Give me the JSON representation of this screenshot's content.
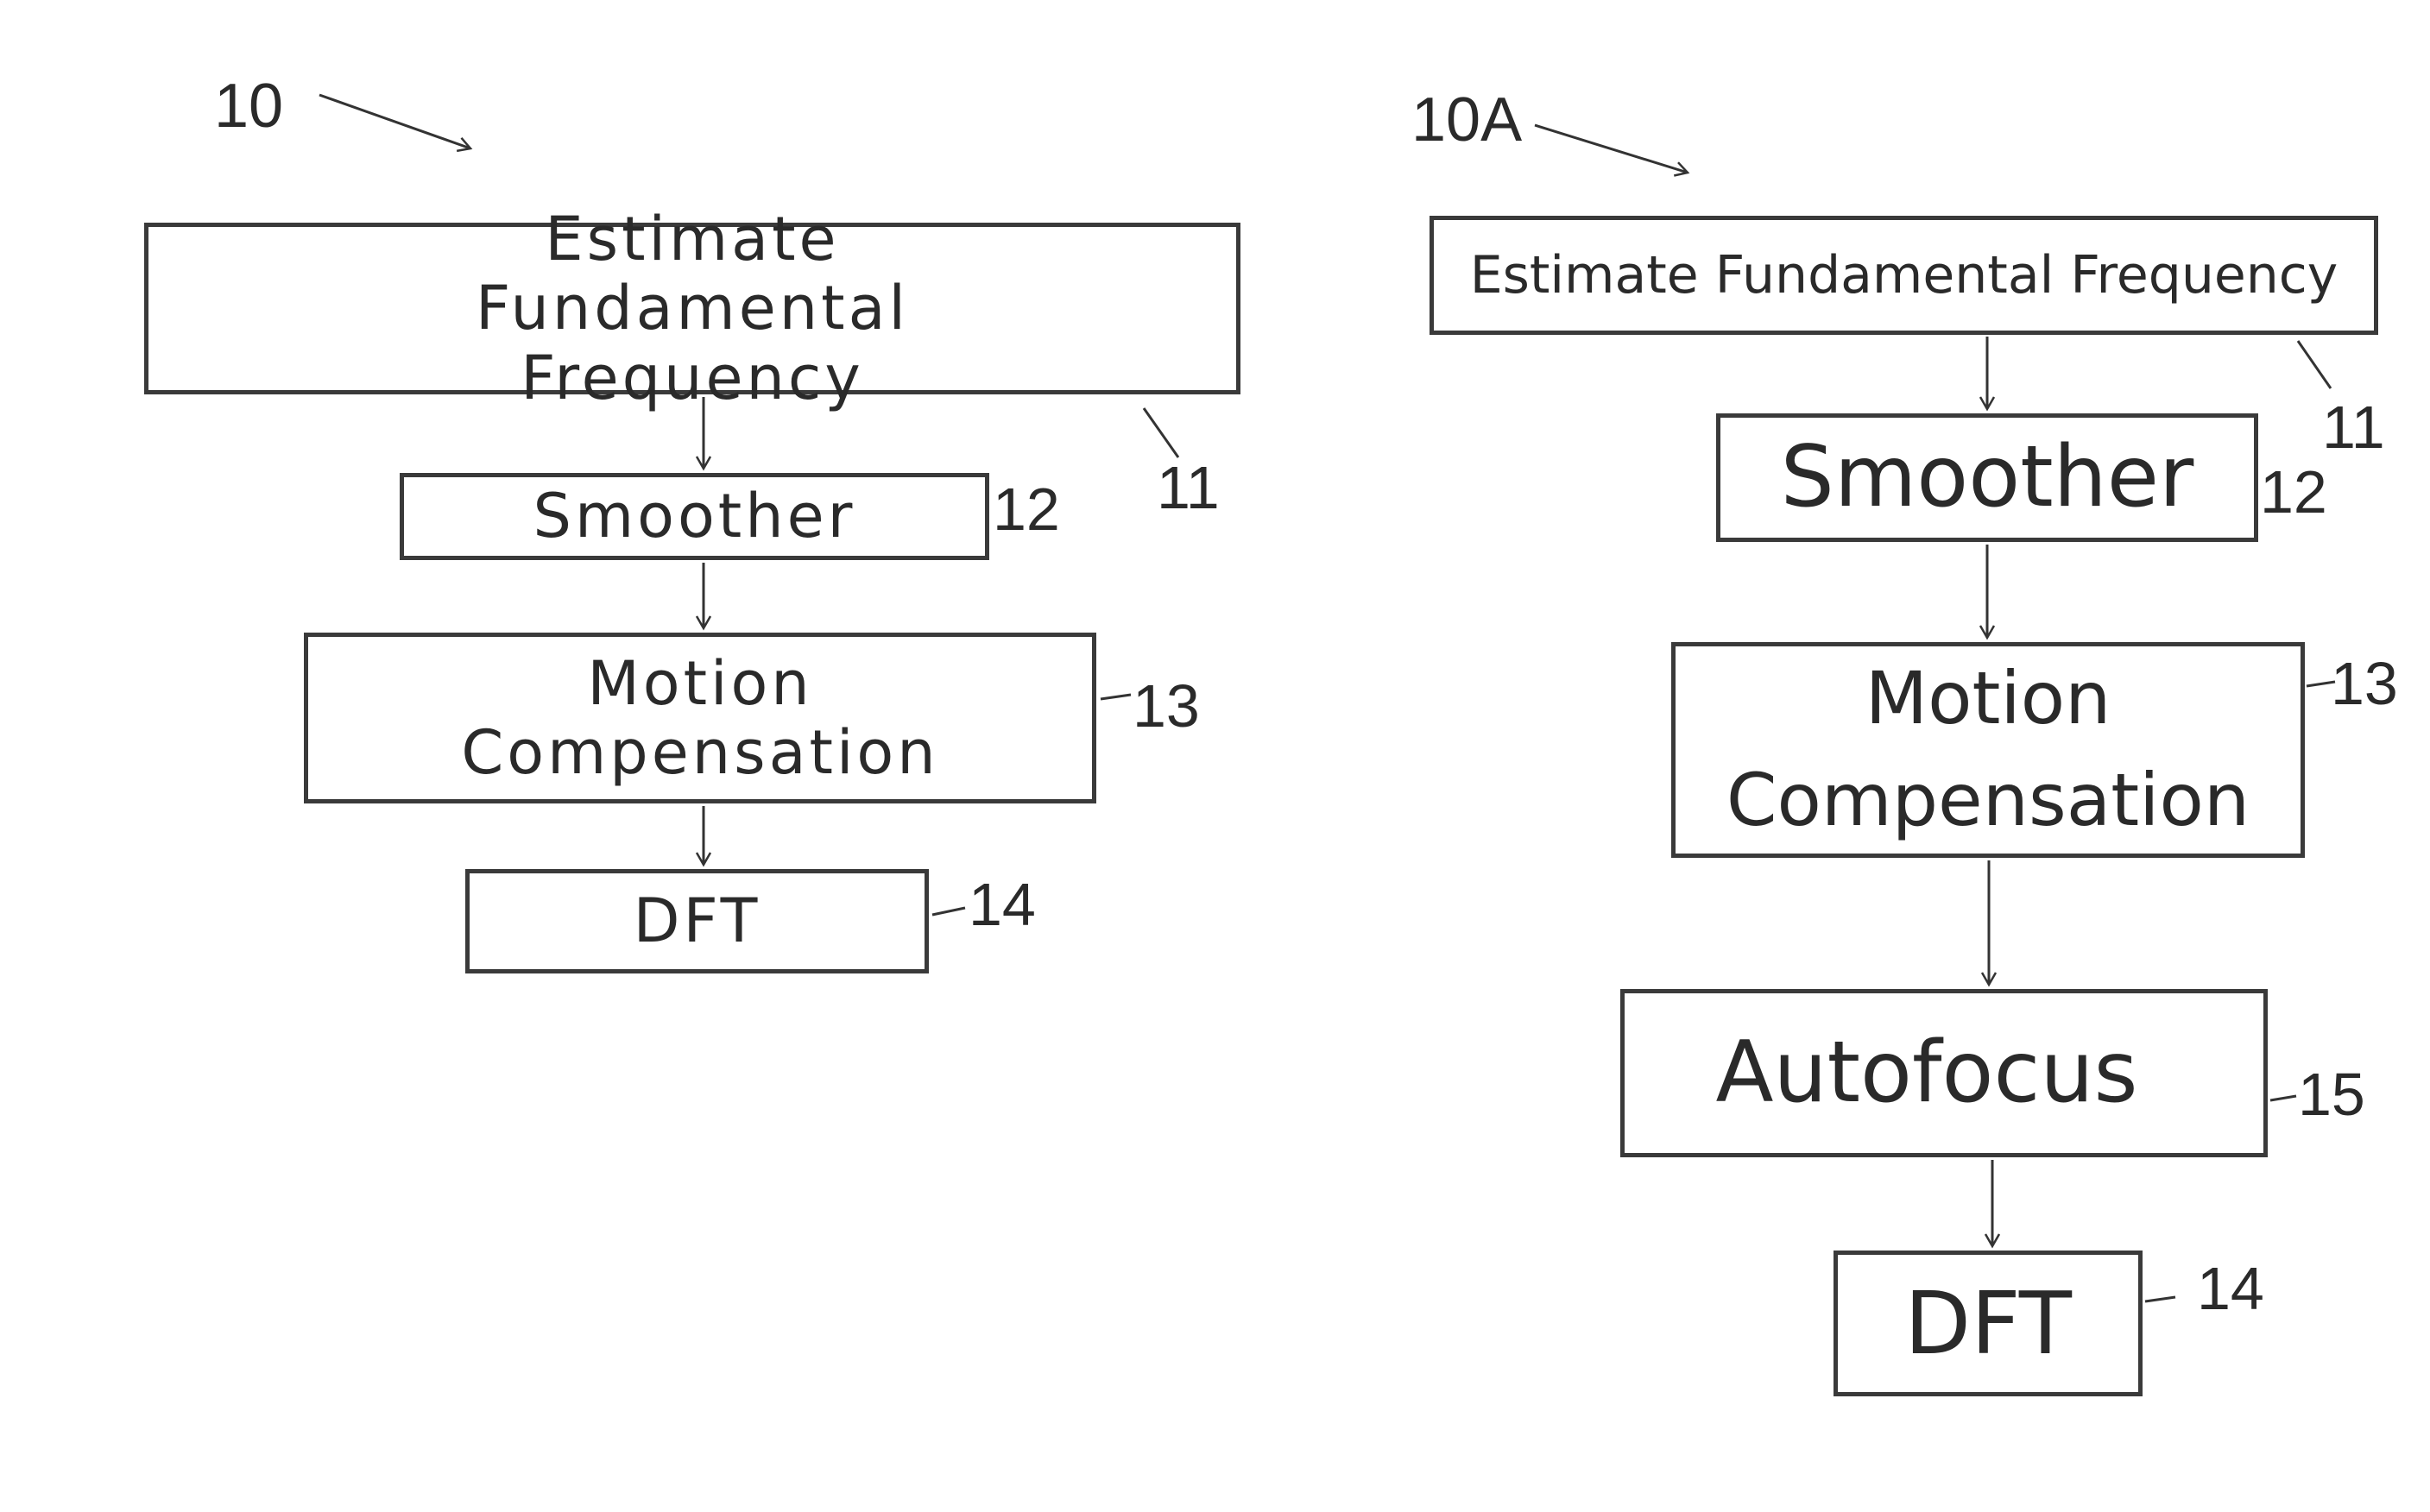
{
  "figures": [
    {
      "ref": "10",
      "steps": [
        {
          "ref": "11",
          "label": "Estimate Fundamental Frequency"
        },
        {
          "ref": "12",
          "label": "Smoother"
        },
        {
          "ref": "13",
          "label": "Motion Compensation"
        },
        {
          "ref": "14",
          "label": "DFT"
        }
      ]
    },
    {
      "ref": "10A",
      "steps": [
        {
          "ref": "11",
          "label": "Estimate Fundamental Frequency"
        },
        {
          "ref": "12",
          "label": "Smoother"
        },
        {
          "ref": "13",
          "label": "Motion Compensation"
        },
        {
          "ref": "15",
          "label": "Autofocus"
        },
        {
          "ref": "14",
          "label": "DFT"
        }
      ]
    }
  ]
}
